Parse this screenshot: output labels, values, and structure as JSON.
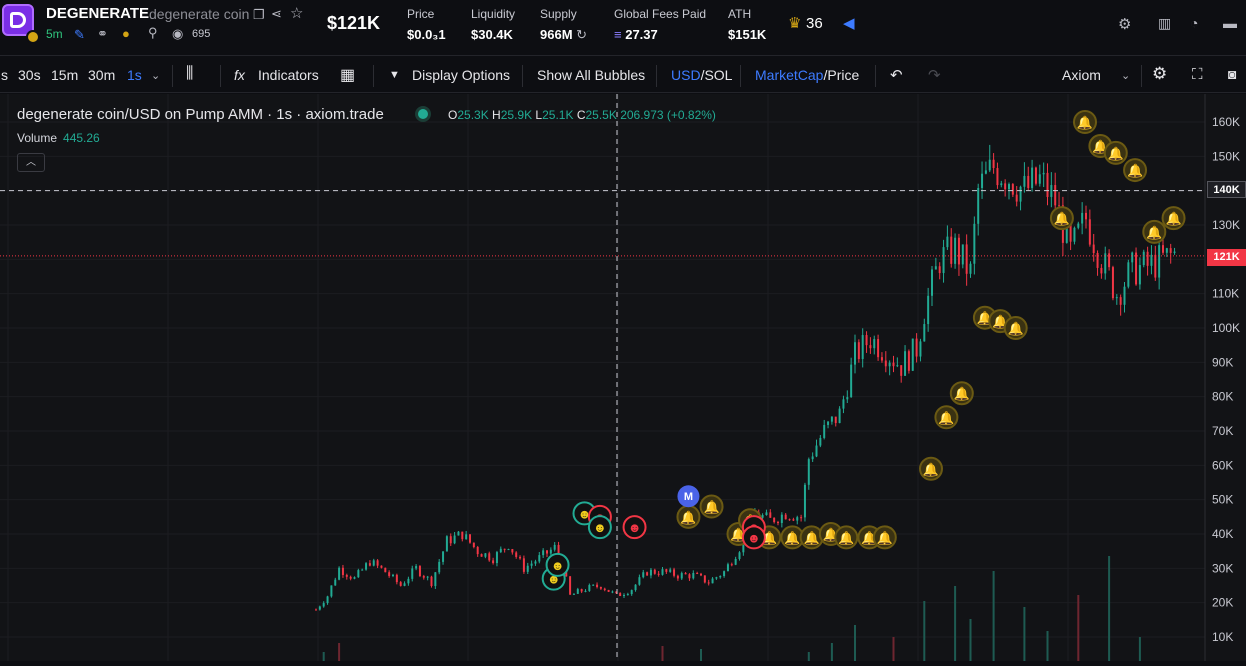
{
  "token": {
    "name": "DEGENERATE",
    "full_name": "degenerate coin",
    "age": "5m",
    "watchers": "695"
  },
  "header": {
    "market_cap": "$121K",
    "stats": [
      {
        "label": "Price",
        "value": "$0.0₃1"
      },
      {
        "label": "Liquidity",
        "value": "$30.4K"
      },
      {
        "label": "Supply",
        "value": "966M"
      },
      {
        "label": "Global Fees Paid",
        "value": "27.37"
      },
      {
        "label": "ATH",
        "value": "$151K"
      }
    ],
    "crown_count": "36"
  },
  "toolbar": {
    "intervals": [
      "s",
      "30s",
      "15m",
      "30m",
      "1s"
    ],
    "active_interval": "1s",
    "indicators": "Indicators",
    "display_options": "Display Options",
    "show_bubbles": "Show All Bubbles",
    "usd": "USD",
    "sol": "SOL",
    "marketcap": "MarketCap",
    "price": "Price",
    "source": "Axiom"
  },
  "chart_header": {
    "title": "degenerate coin/USD on Pump AMM · 1s · axiom.trade",
    "o_label": "O",
    "o": "25.3K",
    "h_label": "H",
    "h": "25.9K",
    "l_label": "L",
    "l": "25.1K",
    "c_label": "C",
    "c": "25.5K",
    "change": "206.973 (+0.82%)",
    "volume_label": "Volume",
    "volume": "445.26"
  },
  "colors": {
    "up": "#22ab94",
    "down": "#f23645",
    "accent": "#3d7bff",
    "bell": "#d3b21a"
  },
  "chart_data": {
    "type": "candlestick",
    "y_ticks": [
      "160K",
      "150K",
      "140K",
      "130K",
      "120K",
      "110K",
      "100K",
      "90K",
      "80K",
      "70K",
      "60K",
      "50K",
      "40K",
      "30K",
      "20K",
      "10K"
    ],
    "y_range": [
      0,
      166000
    ],
    "crosshair_label": "140K",
    "current_label": "121K",
    "current_value": 121000,
    "close_path": [
      [
        0,
        18000
      ],
      [
        3,
        22000
      ],
      [
        6,
        30000
      ],
      [
        10,
        27000
      ],
      [
        14,
        32000
      ],
      [
        18,
        29000
      ],
      [
        22,
        25000
      ],
      [
        26,
        30000
      ],
      [
        30,
        26000
      ],
      [
        34,
        38000
      ],
      [
        38,
        40000
      ],
      [
        42,
        35000
      ],
      [
        46,
        33000
      ],
      [
        50,
        37000
      ],
      [
        54,
        30000
      ],
      [
        58,
        33000
      ],
      [
        62,
        36000
      ],
      [
        64,
        31000
      ],
      [
        66,
        22000
      ],
      [
        70,
        24000
      ],
      [
        74,
        25000
      ],
      [
        78,
        22000
      ],
      [
        82,
        24000
      ],
      [
        86,
        29000
      ],
      [
        90,
        29000
      ],
      [
        94,
        28000
      ],
      [
        98,
        28000
      ],
      [
        102,
        26000
      ],
      [
        106,
        29000
      ],
      [
        110,
        36000
      ],
      [
        114,
        46000
      ],
      [
        118,
        44000
      ],
      [
        122,
        46000
      ],
      [
        126,
        45000
      ],
      [
        128,
        62000
      ],
      [
        132,
        70000
      ],
      [
        136,
        75000
      ],
      [
        140,
        92000
      ],
      [
        144,
        97000
      ],
      [
        148,
        93000
      ],
      [
        152,
        89000
      ],
      [
        156,
        94000
      ],
      [
        158,
        105000
      ],
      [
        162,
        120000
      ],
      [
        166,
        123000
      ],
      [
        170,
        116000
      ],
      [
        172,
        140000
      ],
      [
        176,
        147000
      ],
      [
        180,
        144000
      ],
      [
        184,
        140000
      ],
      [
        188,
        143000
      ],
      [
        192,
        137000
      ],
      [
        196,
        122000
      ],
      [
        200,
        132000
      ],
      [
        204,
        120000
      ],
      [
        208,
        110000
      ],
      [
        212,
        117000
      ],
      [
        216,
        118000
      ],
      [
        220,
        120000
      ],
      [
        224,
        122000
      ]
    ],
    "volume_bars": [
      [
        2,
        3
      ],
      [
        6,
        6
      ],
      [
        90,
        5
      ],
      [
        100,
        4
      ],
      [
        128,
        3
      ],
      [
        134,
        6
      ],
      [
        140,
        12
      ],
      [
        150,
        8
      ],
      [
        158,
        20
      ],
      [
        166,
        25
      ],
      [
        170,
        14
      ],
      [
        176,
        30
      ],
      [
        184,
        18
      ],
      [
        190,
        10
      ],
      [
        198,
        22
      ],
      [
        206,
        35
      ],
      [
        214,
        8
      ]
    ],
    "markers": [
      {
        "kind": "bell",
        "x": 97,
        "v": 45000
      },
      {
        "kind": "bell",
        "x": 103,
        "v": 48000
      },
      {
        "kind": "bell",
        "x": 110,
        "v": 40000
      },
      {
        "kind": "bell",
        "x": 113,
        "v": 44000
      },
      {
        "kind": "bell",
        "x": 118,
        "v": 39000
      },
      {
        "kind": "bell",
        "x": 124,
        "v": 39000
      },
      {
        "kind": "bell",
        "x": 129,
        "v": 39000
      },
      {
        "kind": "bell",
        "x": 134,
        "v": 40000
      },
      {
        "kind": "bell",
        "x": 138,
        "v": 39000
      },
      {
        "kind": "bell",
        "x": 144,
        "v": 39000
      },
      {
        "kind": "bell",
        "x": 148,
        "v": 39000
      },
      {
        "kind": "bell",
        "x": 160,
        "v": 59000
      },
      {
        "kind": "bell",
        "x": 164,
        "v": 74000
      },
      {
        "kind": "bell",
        "x": 168,
        "v": 81000
      },
      {
        "kind": "bell",
        "x": 174,
        "v": 103000
      },
      {
        "kind": "bell",
        "x": 178,
        "v": 102000
      },
      {
        "kind": "bell",
        "x": 182,
        "v": 100000
      },
      {
        "kind": "bell",
        "x": 194,
        "v": 132000
      },
      {
        "kind": "bell",
        "x": 200,
        "v": 160000
      },
      {
        "kind": "bell",
        "x": 204,
        "v": 153000
      },
      {
        "kind": "bell",
        "x": 208,
        "v": 151000
      },
      {
        "kind": "bell",
        "x": 213,
        "v": 146000
      },
      {
        "kind": "bell",
        "x": 218,
        "v": 128000
      },
      {
        "kind": "bell",
        "x": 223,
        "v": 132000
      },
      {
        "kind": "green",
        "x": 62,
        "v": 27000
      },
      {
        "kind": "green",
        "x": 63,
        "v": 31000
      },
      {
        "kind": "green",
        "x": 70,
        "v": 46000
      },
      {
        "kind": "red",
        "x": 74,
        "v": 45000
      },
      {
        "kind": "green",
        "x": 74,
        "v": 42000
      },
      {
        "kind": "red",
        "x": 83,
        "v": 42000
      },
      {
        "kind": "red",
        "x": 114,
        "v": 42000
      },
      {
        "kind": "red",
        "x": 114,
        "v": 39000
      },
      {
        "kind": "m",
        "x": 97,
        "v": 51000
      }
    ]
  }
}
